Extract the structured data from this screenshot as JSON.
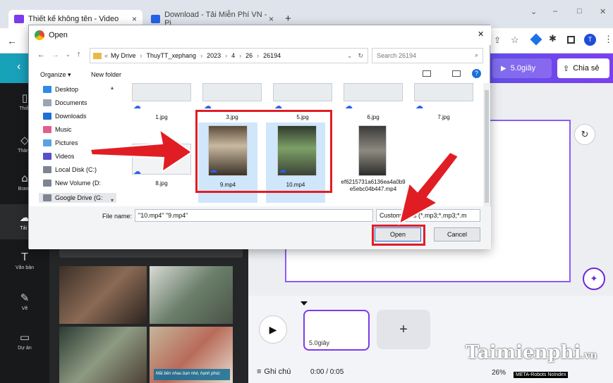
{
  "browser": {
    "tabs": [
      {
        "label": "Thiết kế không tên - Video",
        "close": "×"
      },
      {
        "label": "Download - Tải Miễn Phí VN - Pi",
        "close": "×"
      }
    ],
    "new_tab": "+",
    "win_controls": [
      "⌄",
      "–",
      "□",
      "✕"
    ]
  },
  "canva": {
    "play_duration": "5.0giây",
    "share": "Chia sẻ",
    "sidebar": [
      {
        "label": "Thiết"
      },
      {
        "label": "Thành"
      },
      {
        "label": "Brand"
      },
      {
        "label": "Tải l"
      },
      {
        "label": "Văn bản"
      },
      {
        "label": "Vẽ"
      },
      {
        "label": "Dự án"
      }
    ],
    "clip_label": "5.0giây",
    "note": "Ghi chú",
    "time": "0:00 / 0:05",
    "zoom": "26%",
    "thumb_caption": "Mãi bên nhau bạn nhé, hạnh phúc"
  },
  "dialog": {
    "title": "Open",
    "close": "✕",
    "path": [
      "My Drive",
      "ThuyTT_xephang",
      "2023",
      "4",
      "26",
      "26194"
    ],
    "search_placeholder": "Search 26194",
    "organize": "Organize ▾",
    "new_folder": "New folder",
    "nav_items": [
      "Desktop",
      "Documents",
      "Downloads",
      "Music",
      "Pictures",
      "Videos",
      "Local Disk (C:)",
      "New Volume (D:",
      "Google Drive (G:"
    ],
    "files_top": [
      "1.jpg",
      "3.jpg",
      "5.jpg",
      "6.jpg",
      "7.jpg"
    ],
    "files_bottom": [
      "8.jpg",
      "9.mp4",
      "10.mp4",
      "ef6215731a6136ea4a0b9e5ebc04b447.mp4"
    ],
    "filename_label": "File name:",
    "filename_value": "\"10.mp4\" \"9.mp4\"",
    "filetype_value": "Custom Files (*.mp3;*.mp3;*.m",
    "open_button": "Open",
    "cancel_button": "Cancel"
  },
  "watermark": {
    "text": "Taimienphi",
    "suffix": ".vn",
    "meta": "META-Robots NoIndex"
  },
  "colors": {
    "accent_red": "#e11d24",
    "canva_purple": "#7c3aed",
    "selection": "#cfe6fb"
  }
}
